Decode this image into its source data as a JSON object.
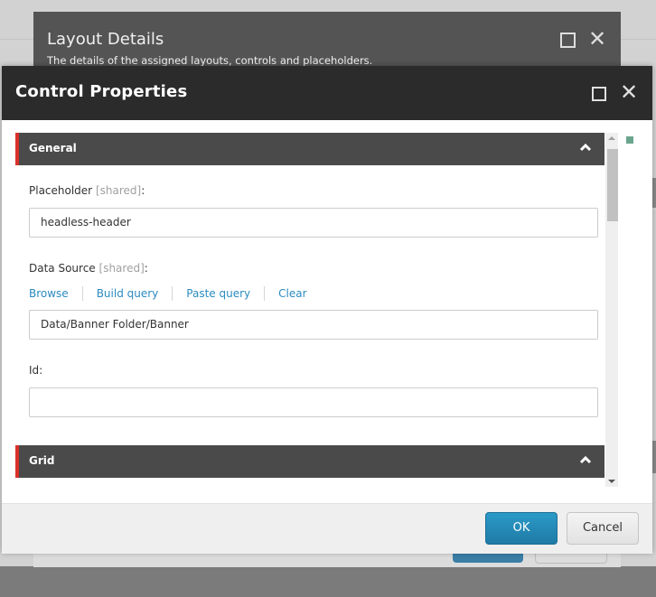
{
  "outer_dialog": {
    "title": "Layout Details",
    "subtitle": "The details of the assigned layouts, controls and placeholders.",
    "maximize_icon": "square-icon",
    "close_icon": "close-x-icon"
  },
  "dialog": {
    "title": "Control Properties",
    "maximize_icon": "square-icon",
    "close_icon": "close-x-icon",
    "close_glyph": "✕",
    "sections": [
      {
        "title": "General",
        "expanded": true,
        "icon": "chevron-up-icon"
      },
      {
        "title": "Grid",
        "expanded": true,
        "icon": "chevron-up-icon"
      }
    ],
    "fields": {
      "placeholder": {
        "label": "Placeholder",
        "tag": "[shared]",
        "suffix": ":",
        "value": "headless-header"
      },
      "data_source": {
        "label": "Data Source",
        "tag": "[shared]",
        "suffix": ":",
        "value": "Data/Banner Folder/Banner",
        "links": [
          "Browse",
          "Build query",
          "Paste query",
          "Clear"
        ]
      },
      "id": {
        "label": "Id:",
        "value": ""
      }
    },
    "footer": {
      "ok_label": "OK",
      "cancel_label": "Cancel"
    },
    "colors": {
      "accent": "#d9312a",
      "link": "#2b8bc0",
      "primary_button": "#2389b8",
      "status_indicator": "#6aa58e"
    }
  }
}
